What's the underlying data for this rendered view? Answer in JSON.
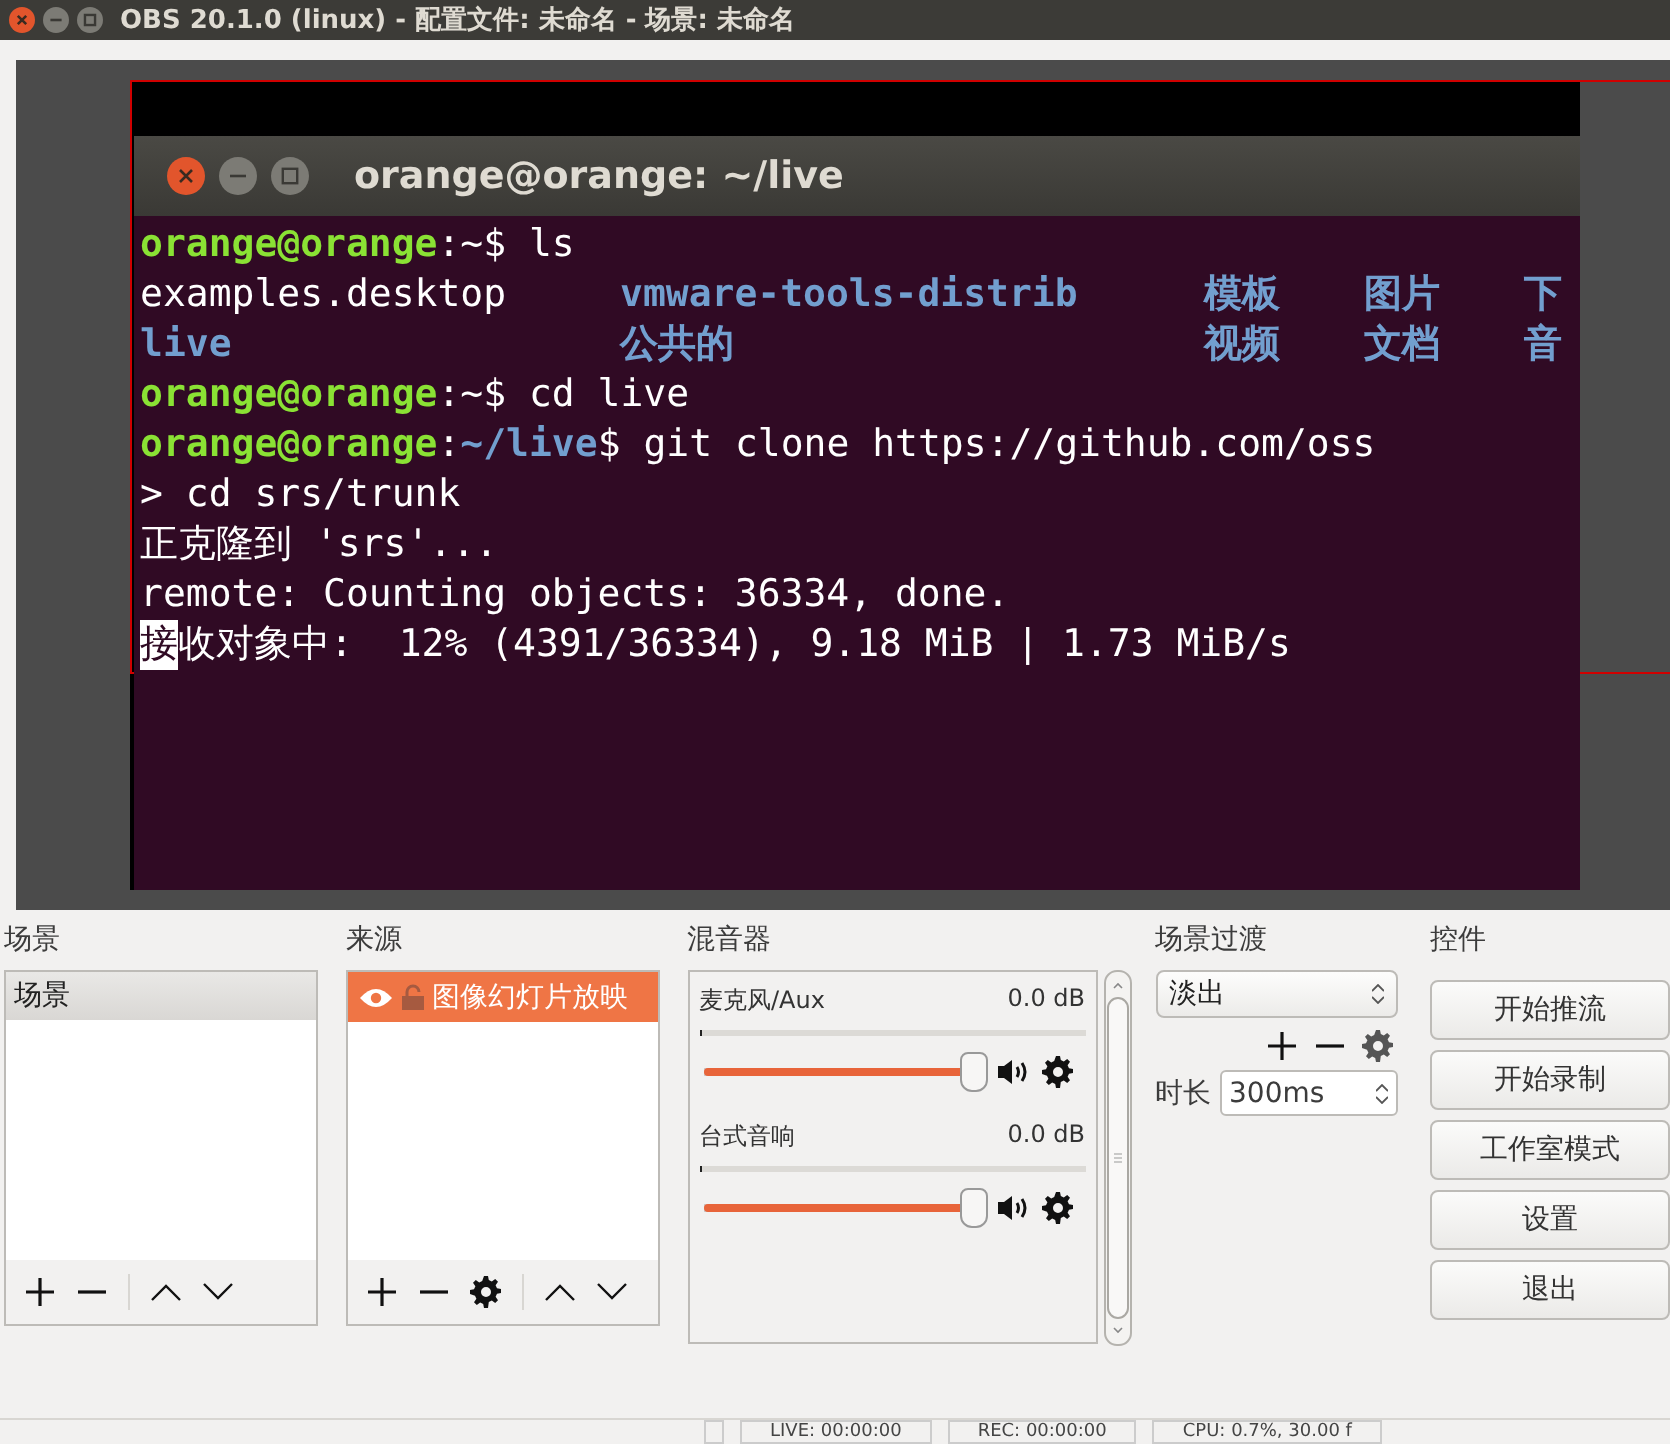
{
  "window": {
    "title": "OBS 20.1.0 (linux) - 配置文件: 未命名 - 场景: 未命名"
  },
  "preview": {
    "terminal": {
      "title": "orange@orange: ~/live",
      "lines": [
        {
          "segments": [
            {
              "kind": "prompt",
              "text": "orange@orange"
            },
            {
              "kind": "plain",
              "text": ":~$ ls"
            }
          ]
        },
        {
          "kind": "grid",
          "cells": [
            {
              "kind": "plain",
              "text": "examples.desktop"
            },
            {
              "kind": "dir",
              "text": "vmware-tools-distrib"
            },
            {
              "kind": "dir",
              "text": "模板"
            },
            {
              "kind": "dir",
              "text": "图片"
            },
            {
              "kind": "dir",
              "text": "下"
            }
          ]
        },
        {
          "kind": "grid",
          "cells": [
            {
              "kind": "dir",
              "text": "live"
            },
            {
              "kind": "dir",
              "text": "公共的"
            },
            {
              "kind": "dir",
              "text": "视频"
            },
            {
              "kind": "dir",
              "text": "文档"
            },
            {
              "kind": "dir",
              "text": "音"
            }
          ]
        },
        {
          "segments": [
            {
              "kind": "prompt",
              "text": "orange@orange"
            },
            {
              "kind": "plain",
              "text": ":~$ cd live"
            }
          ]
        },
        {
          "segments": [
            {
              "kind": "prompt",
              "text": "orange@orange"
            },
            {
              "kind": "plain",
              "text": ":"
            },
            {
              "kind": "dir",
              "text": "~/live"
            },
            {
              "kind": "plain",
              "text": "$ git clone https://github.com/oss"
            }
          ]
        },
        {
          "segments": [
            {
              "kind": "plain",
              "text": "> cd srs/trunk"
            }
          ]
        },
        {
          "segments": [
            {
              "kind": "plain",
              "text": "正克隆到 'srs'..."
            }
          ]
        },
        {
          "segments": [
            {
              "kind": "plain",
              "text": "remote: Counting objects: 36334, done."
            }
          ]
        },
        {
          "segments": [
            {
              "kind": "cursor",
              "text": "接"
            },
            {
              "kind": "plain",
              "text": "收对象中:  12% (4391/36334), 9.18 MiB | 1.73 MiB/s"
            }
          ]
        }
      ]
    }
  },
  "scenes": {
    "title": "场景",
    "items": [
      {
        "label": "场景",
        "selected": true
      }
    ]
  },
  "sources": {
    "title": "来源",
    "items": [
      {
        "label": "图像幻灯片放映",
        "selected": true,
        "visible": true,
        "locked": false
      }
    ]
  },
  "mixer": {
    "title": "混音器",
    "channels": [
      {
        "name": "麦克风/Aux",
        "reading": "0.0 dB",
        "level": 0.97
      },
      {
        "name": "台式音响",
        "reading": "0.0 dB",
        "level": 0.97
      }
    ]
  },
  "transitions": {
    "title": "场景过渡",
    "selected": "淡出",
    "duration_label": "时长",
    "duration": "300ms"
  },
  "controls": {
    "title": "控件",
    "buttons": [
      "开始推流",
      "开始录制",
      "工作室模式",
      "设置",
      "退出"
    ]
  },
  "status_bar": [
    "LIVE: 00:00:00",
    "REC: 00:00:00",
    "CPU: 0.7%, 30.00 f"
  ]
}
